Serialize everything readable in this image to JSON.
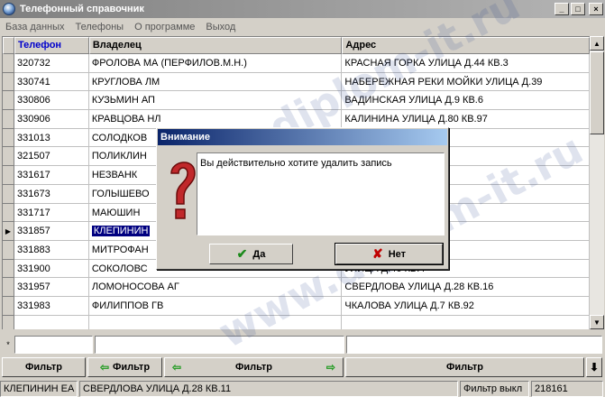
{
  "window": {
    "title": "Телефонный справочник",
    "icon": "app-globe-icon"
  },
  "menu": [
    "База данных",
    "Телефоны",
    "О программе",
    "Выход"
  ],
  "table": {
    "columns": [
      "Телефон",
      "Владелец",
      "Адрес"
    ],
    "active_column": 0,
    "rows": [
      [
        "320732",
        "ФРОЛОВА МА (ПЕРФИЛОВ.М.Н.)",
        "КРАСНАЯ ГОРКА УЛИЦА Д.44 КВ.3"
      ],
      [
        "330741",
        "КРУГЛОВА ЛМ",
        "НАБЕРЕЖНАЯ РЕКИ МОЙКИ УЛИЦА Д.39"
      ],
      [
        "330806",
        "КУЗЬМИН АП",
        "ВАДИНСКАЯ УЛИЦА Д.9 КВ.6"
      ],
      [
        "330906",
        "КРАВЦОВА НЛ",
        "КАЛИНИНА УЛИЦА Д.80 КВ.97"
      ],
      [
        "331013",
        "СОЛОДКОВ",
        "ЛИЦА Д.14 КВ.5"
      ],
      [
        "321507",
        "ПОЛИКЛИН",
        "ЛИЦА Д.51"
      ],
      [
        "331617",
        "НЕЗВАНК",
        "Й ПРОЕЗД Д.1 КВ.65"
      ],
      [
        "331673",
        "ГОЛЫШЕВО",
        "Д.8 КВ.14"
      ],
      [
        "331717",
        "МАЮШИН",
        "Й ПРОЕЗД Д.1 КВ.68"
      ],
      [
        "331857",
        "КЛЕПИНИН",
        "Д.28 КВ.11"
      ],
      [
        "331883",
        "МИТРОФАН",
        "РОСПЕКТ Д.60 КВ.24"
      ],
      [
        "331900",
        "СОКОЛОВС",
        "УЛИЦА Д.46 КВ.4"
      ],
      [
        "331957",
        "ЛОМОНОСОВА АГ",
        "СВЕРДЛОВА УЛИЦА Д.28 КВ.16"
      ],
      [
        "331983",
        "ФИЛИППОВ ГВ",
        "ЧКАЛОВА УЛИЦА Д.7 КВ.92"
      ],
      [
        "",
        "",
        ""
      ]
    ],
    "selected_row": 9
  },
  "filter_buttons": [
    "Фильтр",
    "Фильтр",
    "Фильтр",
    "Фильтр"
  ],
  "status": {
    "owner": "КЛЕПИНИН ЕА",
    "address": "СВЕРДЛОВА УЛИЦА Д.28 КВ.11",
    "filter_state": "Фильтр выкл",
    "count": "218161"
  },
  "dialog": {
    "title": "Внимание",
    "message": "Вы действительно хотите удалить запись",
    "yes_label": "Да",
    "no_label": "Нет",
    "icon": "question-mark-icon"
  },
  "watermark": "www.diplom-it.ru"
}
